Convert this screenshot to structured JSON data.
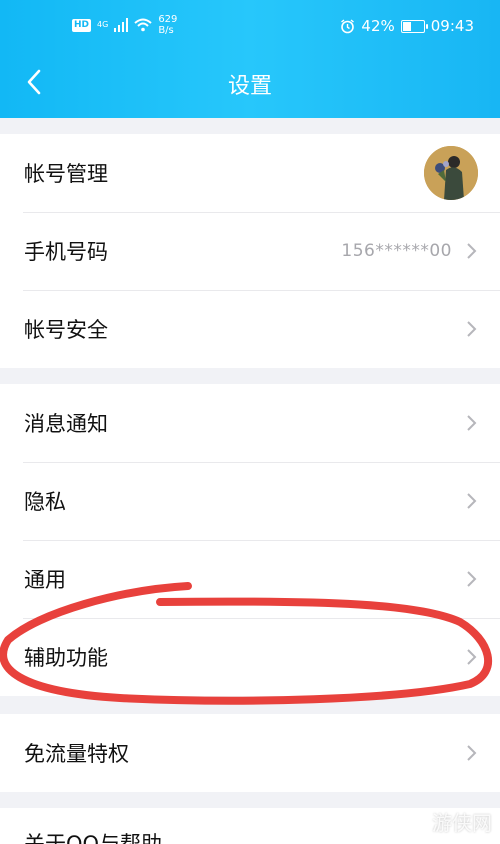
{
  "status_bar": {
    "hd_label": "HD",
    "network_label": "4G",
    "speed_value": "629",
    "speed_unit": "B/s",
    "battery_text": "42%",
    "battery_level": 0.42,
    "time": "09:43"
  },
  "header": {
    "title": "设置"
  },
  "settings": {
    "account_management": "帐号管理",
    "phone_number": {
      "label": "手机号码",
      "value": "156******00"
    },
    "account_security": "帐号安全",
    "notifications": "消息通知",
    "privacy": "隐私",
    "general": "通用",
    "accessibility": "辅助功能",
    "free_data": "免流量特权",
    "about_help": "关于QQ与帮助"
  },
  "annotation": {
    "color": "#e8413c",
    "highlighted_item": "辅助功能"
  },
  "watermark": "游侠网",
  "colors": {
    "header": "#12b8f5",
    "chevron": "#b6b6bb"
  }
}
